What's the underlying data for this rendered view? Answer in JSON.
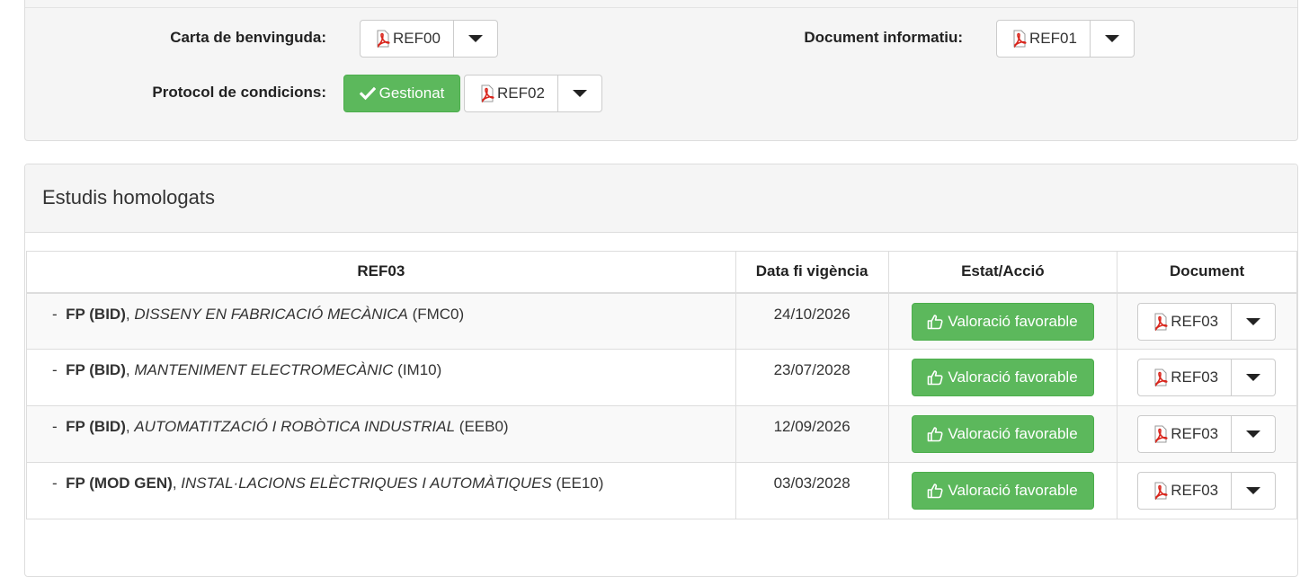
{
  "top_panel": {
    "welcome_letter": {
      "label": "Carta de benvinguda:",
      "doc": "REF00"
    },
    "info_document": {
      "label": "Document informatiu:",
      "doc": "REF01"
    },
    "conditions_protocol": {
      "label": "Protocol de condicions:",
      "status": "Gestionat",
      "doc": "REF02"
    }
  },
  "studies": {
    "title": "Estudis homologats",
    "columns": [
      "REF03",
      "Data fi vigència",
      "Estat/Acció",
      "Document"
    ],
    "rows": [
      {
        "dash": "-",
        "type": "FP (BID)",
        "sep": ",",
        "name": "DISSENY EN FABRICACIÓ MECÀNICA",
        "code": "(FMC0)",
        "date": "24/10/2026",
        "action": "Valoració favorable",
        "doc": "REF03"
      },
      {
        "dash": "-",
        "type": "FP (BID)",
        "sep": ",",
        "name": "MANTENIMENT ELECTROMECÀNIC",
        "code": "(IM10)",
        "date": "23/07/2028",
        "action": "Valoració favorable",
        "doc": "REF03"
      },
      {
        "dash": "-",
        "type": "FP (BID)",
        "sep": ",",
        "name": "AUTOMATITZACIÓ I ROBÒTICA INDUSTRIAL",
        "code": "(EEB0)",
        "date": "12/09/2026",
        "action": "Valoració favorable",
        "doc": "REF03"
      },
      {
        "dash": "-",
        "type": "FP (MOD GEN)",
        "sep": ",",
        "name": "INSTAL·LACIONS ELÈCTRIQUES I AUTOMÀTIQUES",
        "code": "(EE10)",
        "date": "03/03/2028",
        "action": "Valoració favorable",
        "doc": "REF03"
      }
    ]
  },
  "icons": {
    "pdf": "pdf-icon",
    "check": "check-icon",
    "thumbs_up": "thumbs-up-icon",
    "caret": "caret-down-icon"
  },
  "colors": {
    "success": "#5cb85c",
    "panel_bg": "#f5f5f5",
    "border": "#dddddd",
    "pdf_red": "#d9251c"
  }
}
